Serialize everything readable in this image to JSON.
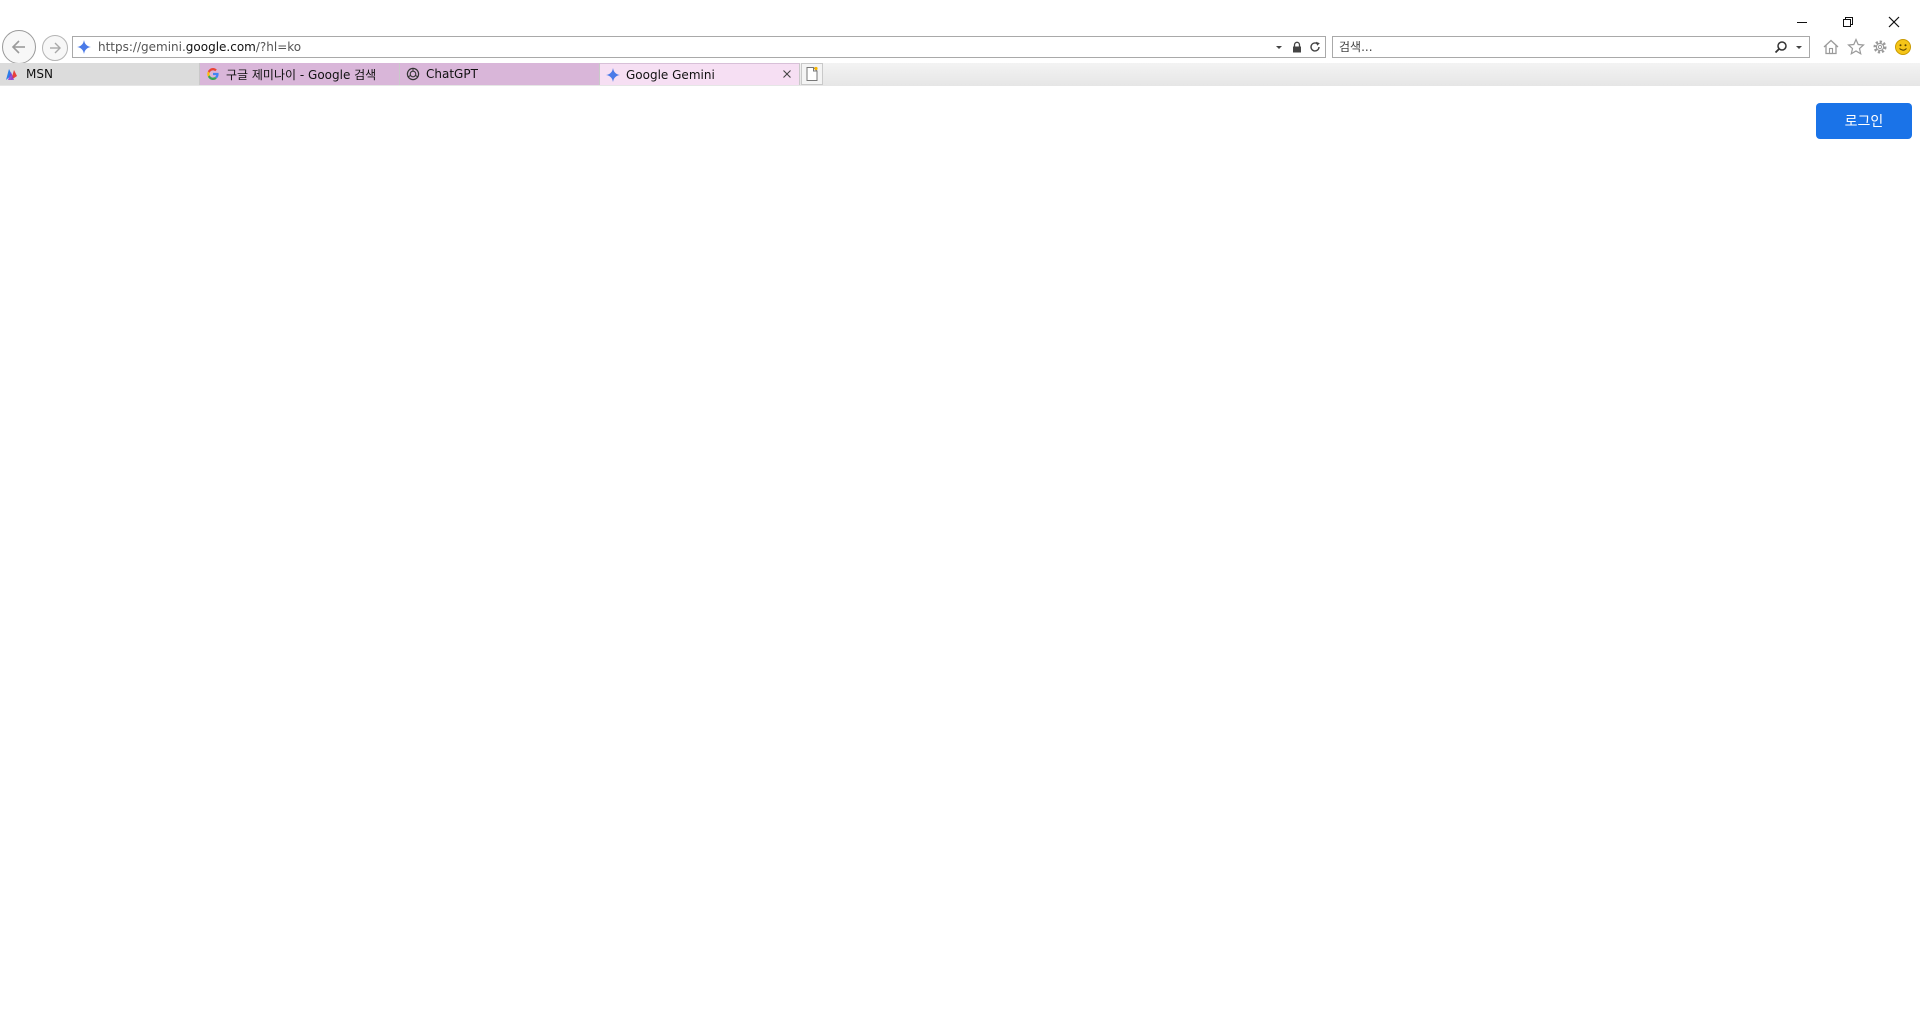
{
  "window": {
    "controls": [
      "minimize",
      "restore",
      "close"
    ]
  },
  "address_bar": {
    "url_prefix": "https://gemini.",
    "url_host": "google.com",
    "url_suffix": "/?hl=ko"
  },
  "search": {
    "placeholder": "검색..."
  },
  "tabs": [
    {
      "label": "MSN",
      "icon": "msn-icon",
      "active": false,
      "color": "#dcdcdc"
    },
    {
      "label": "구글 제미나이 - Google 검색",
      "icon": "google-icon",
      "active": false,
      "color": "#d9b6d9"
    },
    {
      "label": "ChatGPT",
      "icon": "chatgpt-icon",
      "active": false,
      "color": "#d9b6d9"
    },
    {
      "label": "Google Gemini",
      "icon": "gemini-icon",
      "active": true,
      "color": "#f6dff3"
    }
  ],
  "toolbar_icons": [
    "home-icon",
    "favorites-star-icon",
    "gear-icon",
    "smiley-feedback-icon"
  ],
  "page": {
    "login_label": "로그인",
    "login_color": "#1a73e8"
  }
}
